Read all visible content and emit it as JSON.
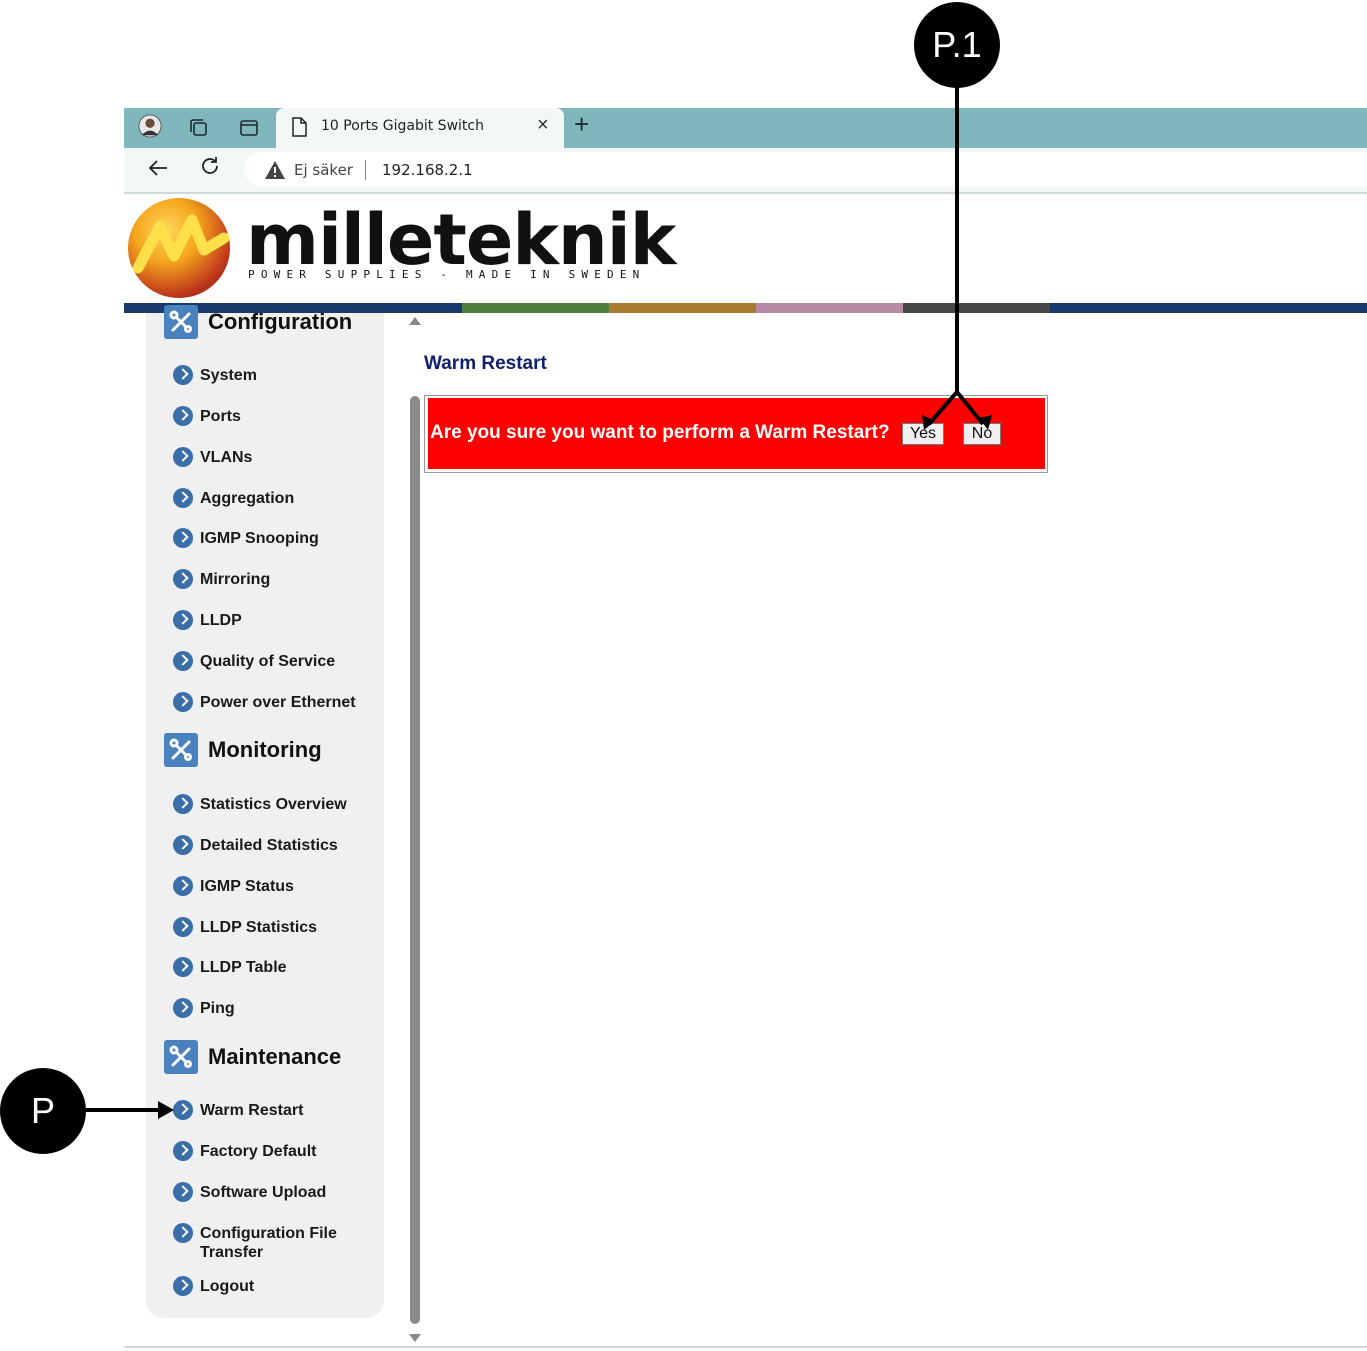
{
  "browser": {
    "tab_title": "10 Ports Gigabit Switch",
    "tab_close": "×",
    "new_tab": "+",
    "security_label": "Ej säker",
    "url": "192.168.2.1"
  },
  "logo": {
    "brand": "milleteknik",
    "tagline": "POWER SUPPLIES - MADE IN SWEDEN"
  },
  "colors": {
    "accent_bar": [
      "#1a3a6e",
      "#4f7d3b",
      "#a87a2e",
      "#b889a4",
      "#484848",
      "#1a3a6e"
    ],
    "dialog_bg": "#ff0000",
    "title_color": "#10206e"
  },
  "sidebar": {
    "sections": [
      {
        "title": "Configuration",
        "icon": "tools-icon",
        "items": [
          "System",
          "Ports",
          "VLANs",
          "Aggregation",
          "IGMP Snooping",
          "Mirroring",
          "LLDP",
          "Quality of Service",
          "Power over Ethernet"
        ]
      },
      {
        "title": "Monitoring",
        "icon": "tools-icon",
        "items": [
          "Statistics Overview",
          "Detailed Statistics",
          "IGMP Status",
          "LLDP Statistics",
          "LLDP Table",
          "Ping"
        ]
      },
      {
        "title": "Maintenance",
        "icon": "tools-icon",
        "items": [
          "Warm Restart",
          "Factory Default",
          "Software Upload",
          "Configuration File Transfer",
          "Logout"
        ]
      }
    ]
  },
  "main": {
    "title": "Warm Restart",
    "dialog": {
      "message": "Are you sure you want to perform a Warm Restart?",
      "yes_label": "Yes",
      "no_label": "No"
    }
  },
  "annotations": {
    "callout_p1": "P.1",
    "callout_p": "P"
  }
}
